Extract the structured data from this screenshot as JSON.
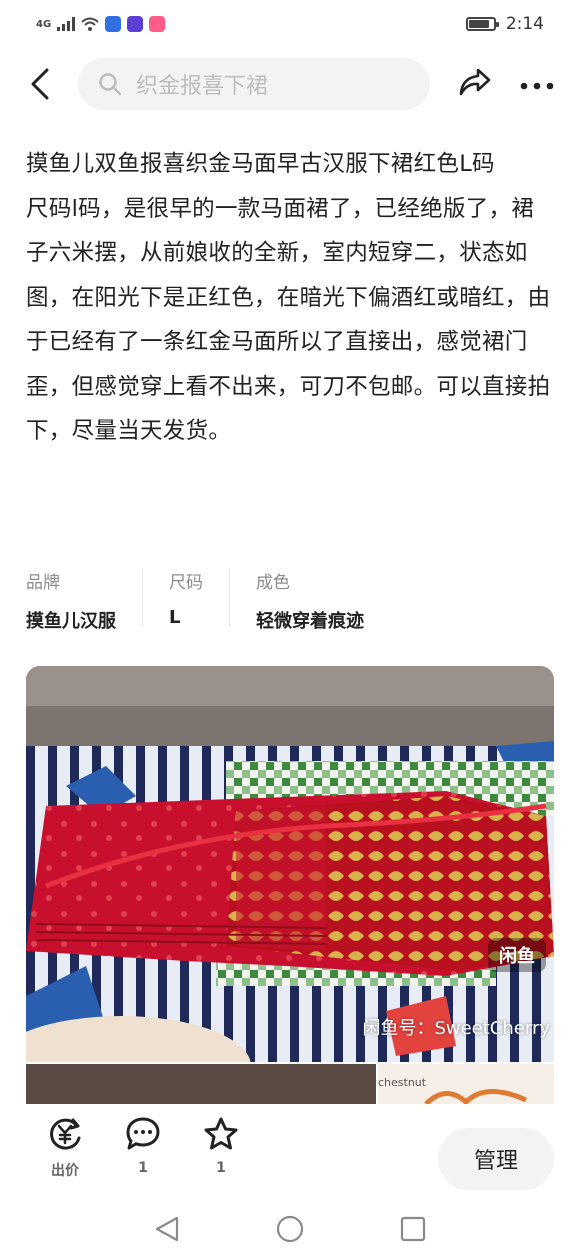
{
  "status_bar": {
    "network": "4G",
    "time": "2:14",
    "battery_level": 0.85
  },
  "nav": {
    "search_placeholder": "织金报喜下裙"
  },
  "product": {
    "title": "摸鱼儿双鱼报喜织金马面早古汉服下裙红色L码",
    "description": "尺码l码，是很早的一款马面裙了，已经绝版了，裙子六米摆，从前娘收的全新，室内短穿二，状态如图，在阳光下是正红色，在暗光下偏酒红或暗红，由于已经有了一条红金马面所以了直接出，感觉裙门歪，但感觉穿上看不出来，可刀不包邮。可以直接拍下，尽量当天发货。",
    "attributes": [
      {
        "key": "品牌",
        "value": "摸鱼儿汉服"
      },
      {
        "key": "尺码",
        "value": "L"
      },
      {
        "key": "成色",
        "value": "轻微穿着痕迹"
      }
    ]
  },
  "photo": {
    "watermark_logo": "闲鱼",
    "watermark_text": "闲鱼号：SweetCherry",
    "second_photo_text": "chestnut"
  },
  "bottom_bar": {
    "offer": {
      "label": "出价",
      "icon": "yuan-offer-icon"
    },
    "comments": {
      "count": "1",
      "icon": "comment-icon"
    },
    "favorites": {
      "count": "1",
      "icon": "star-icon"
    },
    "manage_label": "管理"
  },
  "colors": {
    "skirt_red": "#c8102e",
    "gold": "#d8b24a",
    "button_bg": "#f3f3f3"
  }
}
